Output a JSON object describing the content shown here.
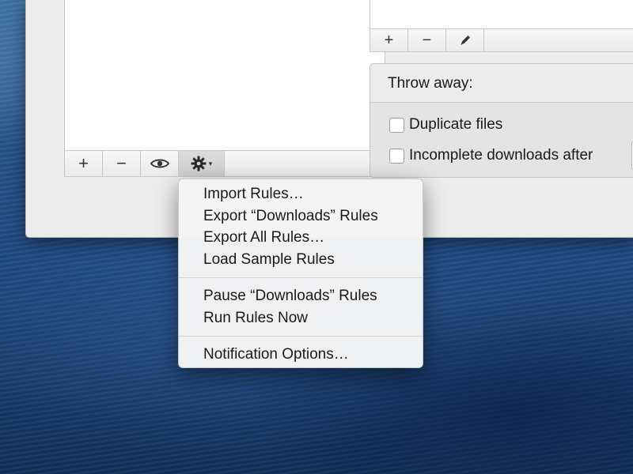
{
  "left_toolbar": {
    "add": "+",
    "remove": "−",
    "preview": "👁",
    "gear": "✲",
    "caret": "▾"
  },
  "right_toolbar": {
    "add": "+",
    "remove": "−",
    "edit": "✎"
  },
  "throw_away": {
    "title": "Throw away:",
    "options": [
      {
        "label": "Duplicate files",
        "checked": false
      },
      {
        "label": "Incomplete downloads after",
        "checked": false
      }
    ]
  },
  "menu": {
    "group1": [
      "Import Rules…",
      "Export “Downloads” Rules",
      "Export All Rules…",
      "Load Sample Rules"
    ],
    "group2": [
      "Pause “Downloads” Rules",
      "Run Rules Now"
    ],
    "group3": [
      "Notification Options…"
    ]
  },
  "icons": {
    "add": "plus-icon",
    "remove": "minus-icon",
    "preview": "eye-icon",
    "gear": "gear-icon",
    "edit": "pencil-icon"
  }
}
